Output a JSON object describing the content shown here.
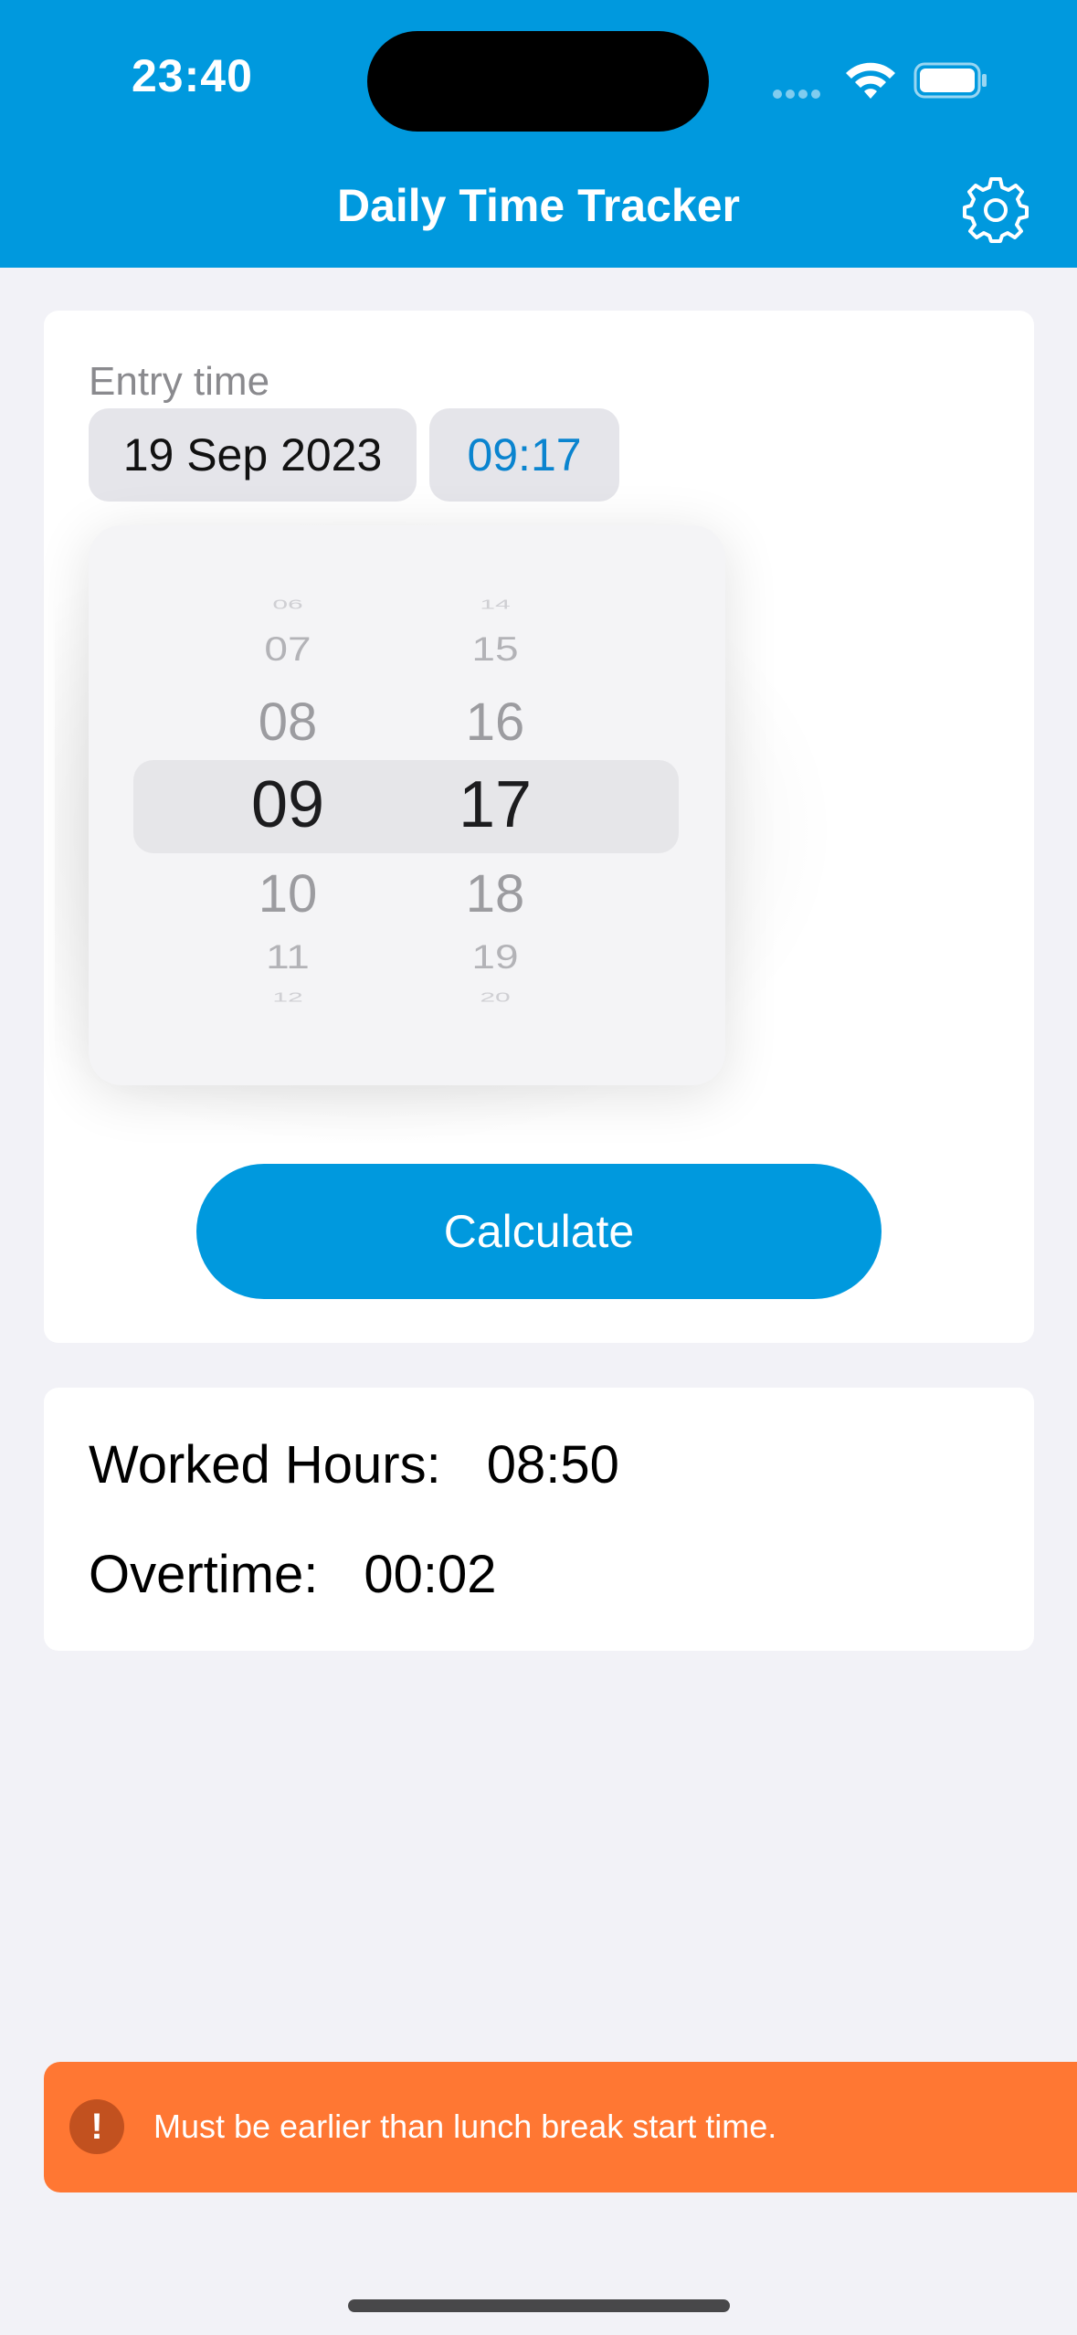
{
  "status_bar": {
    "time": "23:40"
  },
  "nav": {
    "title": "Daily Time Tracker",
    "settings_icon": "gear-icon"
  },
  "entry": {
    "label": "Entry time",
    "date": "19 Sep 2023",
    "time": "09:17"
  },
  "picker": {
    "hours": [
      "06",
      "07",
      "08",
      "09",
      "10",
      "11",
      "12"
    ],
    "minutes": [
      "14",
      "15",
      "16",
      "17",
      "18",
      "19",
      "20"
    ],
    "selected_hour": "09",
    "selected_minute": "17"
  },
  "calculate_label": "Calculate",
  "results": {
    "worked_label": "Worked Hours:",
    "worked_value": "08:50",
    "overtime_label": "Overtime:",
    "overtime_value": "00:02"
  },
  "toast": {
    "icon": "!",
    "message": "Must be earlier than lunch break start time."
  },
  "colors": {
    "accent": "#0099de",
    "toast": "#ff7733",
    "background": "#f2f2f7"
  }
}
